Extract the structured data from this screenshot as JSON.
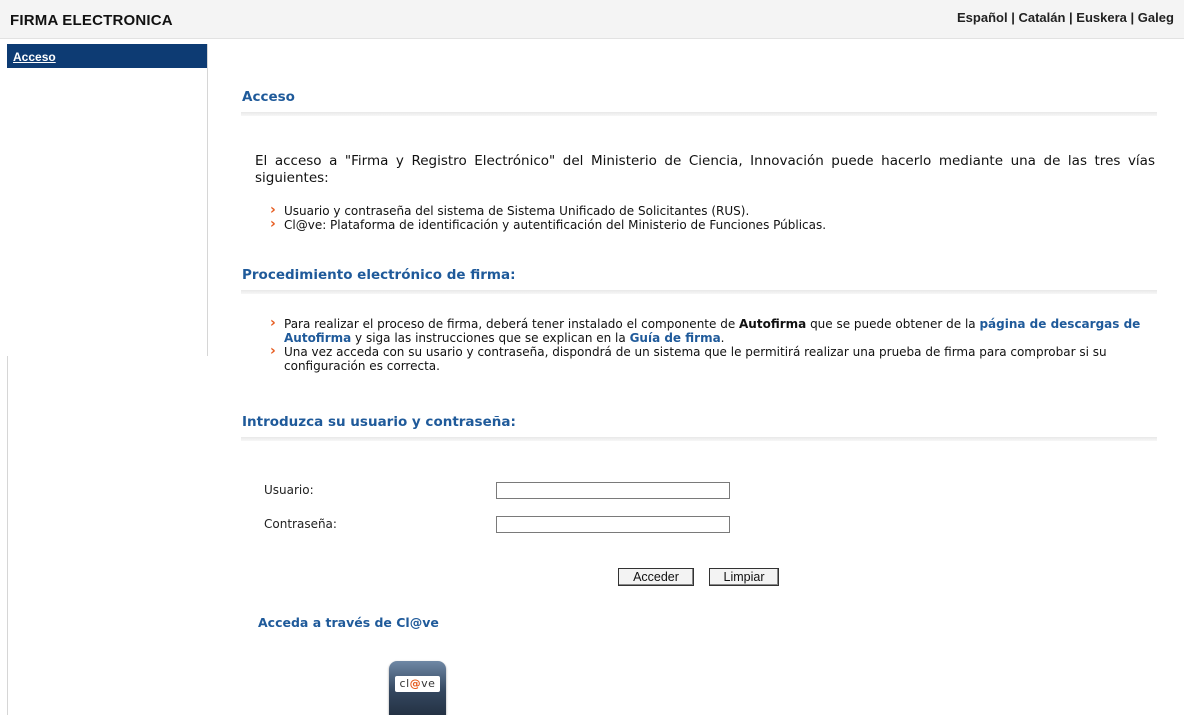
{
  "header": {
    "title": "FIRMA ELECTRONICA",
    "languages": [
      "Español",
      "Catalán",
      "Euskera",
      "Galeg"
    ],
    "separator": " | "
  },
  "sidebar": {
    "items": [
      {
        "label": "Acceso"
      }
    ]
  },
  "access": {
    "title": "Acceso",
    "intro": "El acceso a \"Firma y Registro Electrónico\" del Ministerio de Ciencia, Innovación puede hacerlo mediante una de las tres vías siguientes:",
    "options": [
      "Usuario y contraseña del sistema de Sistema Unificado de Solicitantes (RUS).",
      "Cl@ve: Plataforma de identificación y autentificación del Ministerio de Funciones Públicas."
    ]
  },
  "procedure": {
    "title": "Procedimiento electrónico de firma:",
    "item1": {
      "before": "Para realizar el proceso de firma, deberá tener instalado el componente de ",
      "bold": "Autofirma",
      "middle": " que se puede obtener de la ",
      "link1": "página de descargas de Autofirma",
      "after": " y siga las instrucciones que se explican en la ",
      "link2": "Guía de firma",
      "end": "."
    },
    "item2": "Una vez acceda con su usario y contraseña, dispondrá de un sistema que le permitirá realizar una prueba de firma para comprobar si su configuración es correcta."
  },
  "login": {
    "title": "Introduzca su usuario y contraseña:",
    "user_label": "Usuario:",
    "user_value": "",
    "password_label": "Contraseña:",
    "password_value": "",
    "submit_label": "Acceder",
    "clear_label": "Limpiar"
  },
  "clave": {
    "title": "Acceda a través de Cl@ve",
    "logo_text_left": "cl",
    "logo_text_at": "@",
    "logo_text_right": "ve"
  },
  "colors": {
    "brand_blue": "#1f5a9a",
    "sidebar_active": "#0d3b73",
    "bullet_orange": "#e65a1e"
  }
}
